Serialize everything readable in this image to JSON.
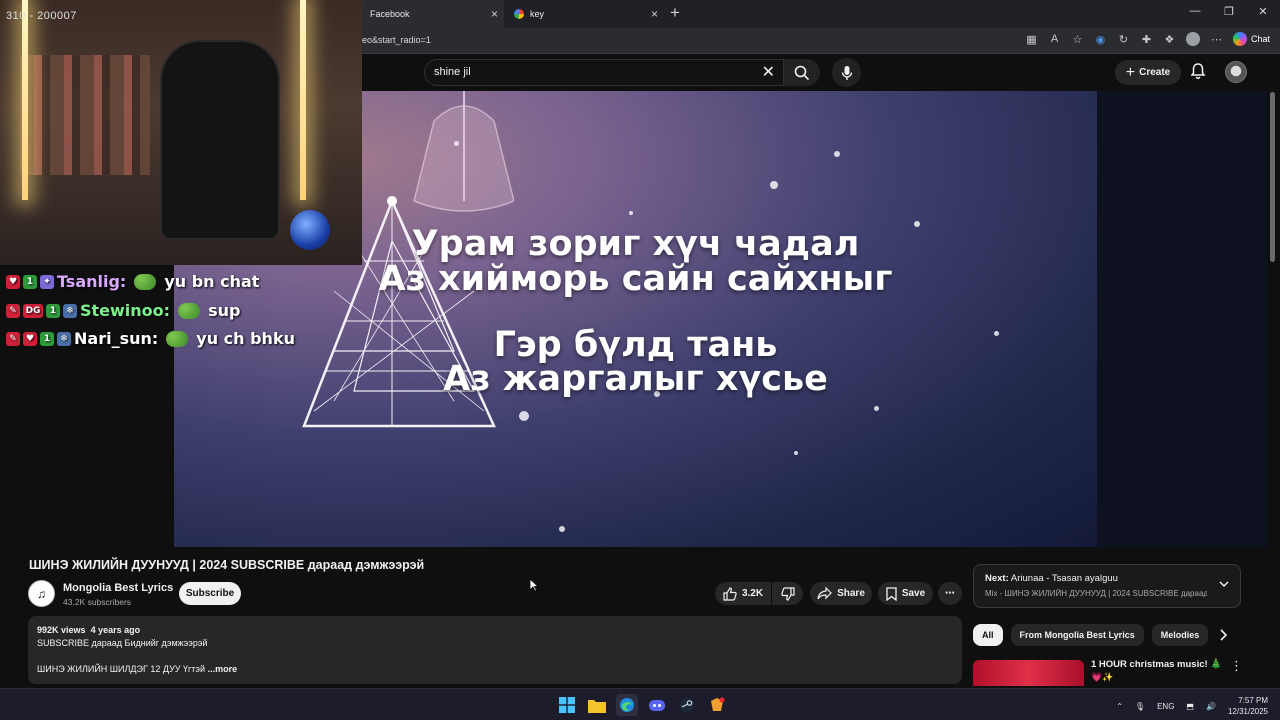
{
  "browser": {
    "tabs": [
      {
        "label": "Facebook"
      },
      {
        "label": "key"
      }
    ],
    "url": "eo&start_radio=1",
    "chat_label": "Chat"
  },
  "youtube": {
    "search_value": "shine jil",
    "create_label": "Create"
  },
  "stream_overlay": {
    "code": "310 - 200007",
    "chat": [
      {
        "user": "Tsanlig:",
        "message": "yu bn chat",
        "user_color": "#d9a8ff",
        "badges": [
          "♥",
          "1",
          "✦"
        ]
      },
      {
        "user": "Stewinoo:",
        "message": "sup",
        "user_color": "#7cf08a",
        "badges": [
          "✎",
          "DG",
          "1",
          "❄"
        ]
      },
      {
        "user": "Nari_sun:",
        "message": "yu ch bhku",
        "user_color": "#ffffff",
        "badges": [
          "✎",
          "♥",
          "1",
          "❄"
        ]
      }
    ]
  },
  "video": {
    "lyrics": [
      "Урам зориг хүч чадал",
      "Аз хийморь сайн сайхныг",
      "Гэр бүлд тань",
      "Аз жаргалыг хүсье"
    ],
    "title": "ШИНЭ ЖИЛИЙН ДУУНУУД | 2024 SUBSCRIBE дараад дэмжээрэй",
    "channel": "Mongolia Best Lyrics",
    "subscribers": "43.2K subscribers",
    "subscribe_label": "Subscribe",
    "likes": "3.2K",
    "share_label": "Share",
    "save_label": "Save"
  },
  "description": {
    "views": "992K views",
    "age": "4 years ago",
    "line1": "SUBSCRIBE дараад Биднийг дэмжээрэй",
    "line2": "ШИНЭ ЖИЛИЙН ШИЛДЭГ 12 ДУУ Үгтэй",
    "more_label": "...more"
  },
  "up_next": {
    "prefix": "Next:",
    "title": "Ariunaa - Tsasan ayalguu",
    "subtitle": "Mix - ШИНЭ ЖИЛИЙН ДУУНУУД | 2024 SUBSCRIBE дараад..."
  },
  "chips": [
    "All",
    "From Mongolia Best Lyrics",
    "Melodies"
  ],
  "recommendation": {
    "title": "1 HOUR christmas music! 🎄",
    "emoji": "💗✨"
  },
  "taskbar": {
    "lang": "ENG",
    "time": "7:57 PM",
    "date": "12/31/2025"
  },
  "colors": {
    "yt_bg": "#0f0f0f",
    "pill_bg": "#272727",
    "text": "#f1f1f1"
  }
}
